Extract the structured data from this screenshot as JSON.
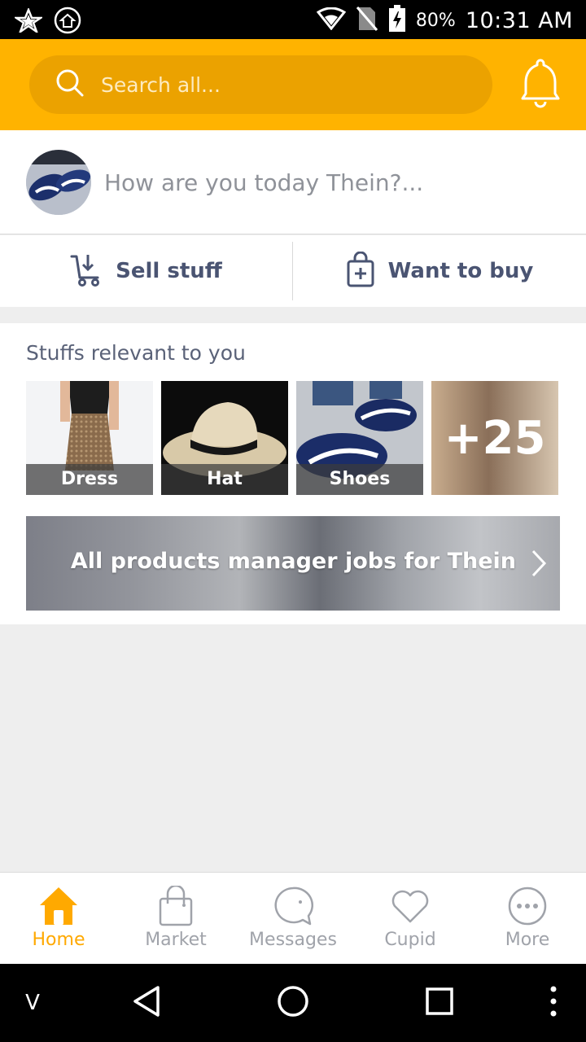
{
  "status_bar": {
    "battery": "80%",
    "time": "10:31 AM",
    "icons": [
      "star-badge-icon",
      "home-badge-icon",
      "wifi-icon",
      "no-sim-icon",
      "battery-charging-icon"
    ]
  },
  "header": {
    "search_placeholder": "Search all...",
    "accent_color": "#ffb300",
    "icons": [
      "search-icon",
      "bell-icon"
    ]
  },
  "post": {
    "prompt": "How are you today Thein?..."
  },
  "actions": {
    "sell_label": "Sell stuff",
    "buy_label": "Want to buy"
  },
  "relevant": {
    "title": "Stuffs relevant to you",
    "items": [
      {
        "label": "Dress"
      },
      {
        "label": "Hat"
      },
      {
        "label": "Shoes"
      }
    ],
    "more_count": "+25"
  },
  "jobs_banner": {
    "text": "All products manager jobs for Thein"
  },
  "bottom_nav": {
    "items": [
      {
        "label": "Home",
        "icon": "home-icon",
        "active": true
      },
      {
        "label": "Market",
        "icon": "shopping-bag-icon",
        "active": false
      },
      {
        "label": "Messages",
        "icon": "chat-bubble-icon",
        "active": false
      },
      {
        "label": "Cupid",
        "icon": "heart-icon",
        "active": false
      },
      {
        "label": "More",
        "icon": "more-dots-icon",
        "active": false
      }
    ]
  },
  "system_nav": {
    "left_label": "V"
  }
}
